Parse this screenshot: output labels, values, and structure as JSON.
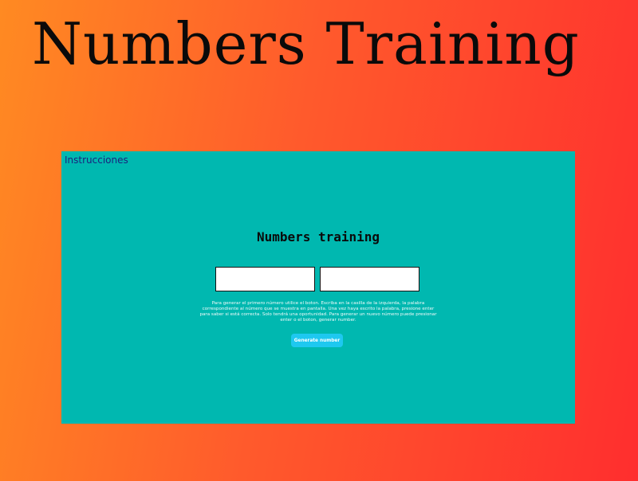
{
  "page": {
    "hero_title": "Numbers Training"
  },
  "app": {
    "instructions_link": "Instrucciones",
    "title": "Numbers training",
    "number_input": {
      "value": "",
      "placeholder": ""
    },
    "word_input": {
      "value": "",
      "placeholder": ""
    },
    "instructions_text": "Para generar el primero número utilice el boton. Escriba en la casilla de la izquierda, la palabra correspondiente al número que se muestra en pantalla. Una vez haya escrito la palabra, presione enter para saber si está correcta. Solo tendrá una oportunidad. Para generar un nuevo número puede presionar enter o el boton, generar number.",
    "generate_button": "Generate number"
  },
  "colors": {
    "background_start": "#ff8a22",
    "background_end": "#ff2e2e",
    "frame": "#00b8b0",
    "link": "#1a237e",
    "button": "#1ec8f0"
  }
}
